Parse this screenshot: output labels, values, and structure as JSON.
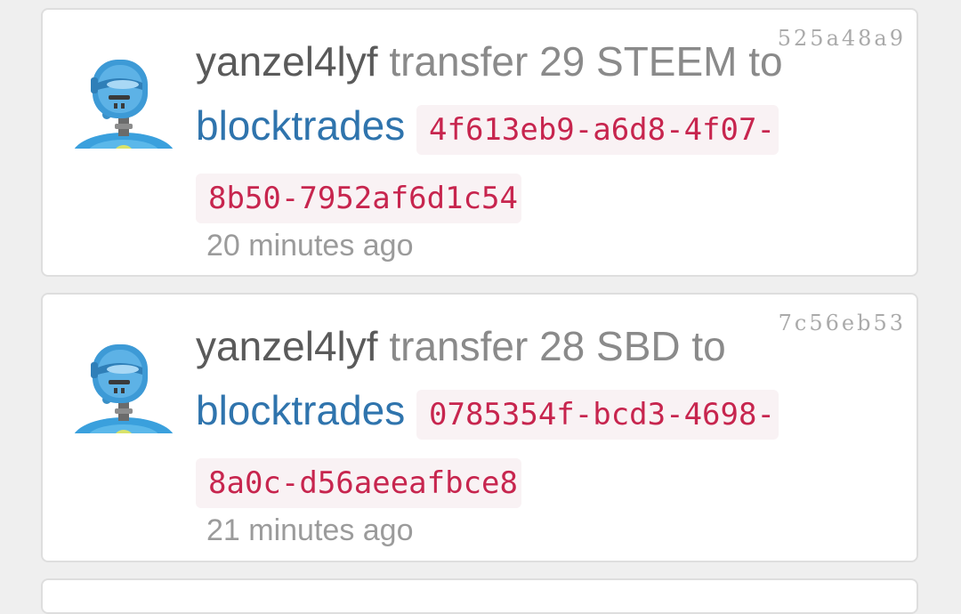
{
  "feed": {
    "items": [
      {
        "tx_id": "525a48a9",
        "user": "yanzel4lyf",
        "action_text": " transfer 29 STEEM to ",
        "recipient": "blocktrades",
        "memo": "4f613eb9-a6d8-4f07-8b50-7952af6d1c54",
        "time": "20 minutes ago"
      },
      {
        "tx_id": "7c56eb53",
        "user": "yanzel4lyf",
        "action_text": " transfer 28 SBD to ",
        "recipient": "blocktrades",
        "memo": "0785354f-bcd3-4698-8a0c-d56aeeafbce8",
        "time": "21 minutes ago"
      }
    ]
  },
  "colors": {
    "link": "#2f74ad",
    "memo_text": "#c7254e",
    "memo_bg": "#f9f2f4",
    "card_bg": "#ffffff",
    "page_bg": "#efefef"
  },
  "icons": {
    "avatar": "robot-avatar-icon"
  }
}
